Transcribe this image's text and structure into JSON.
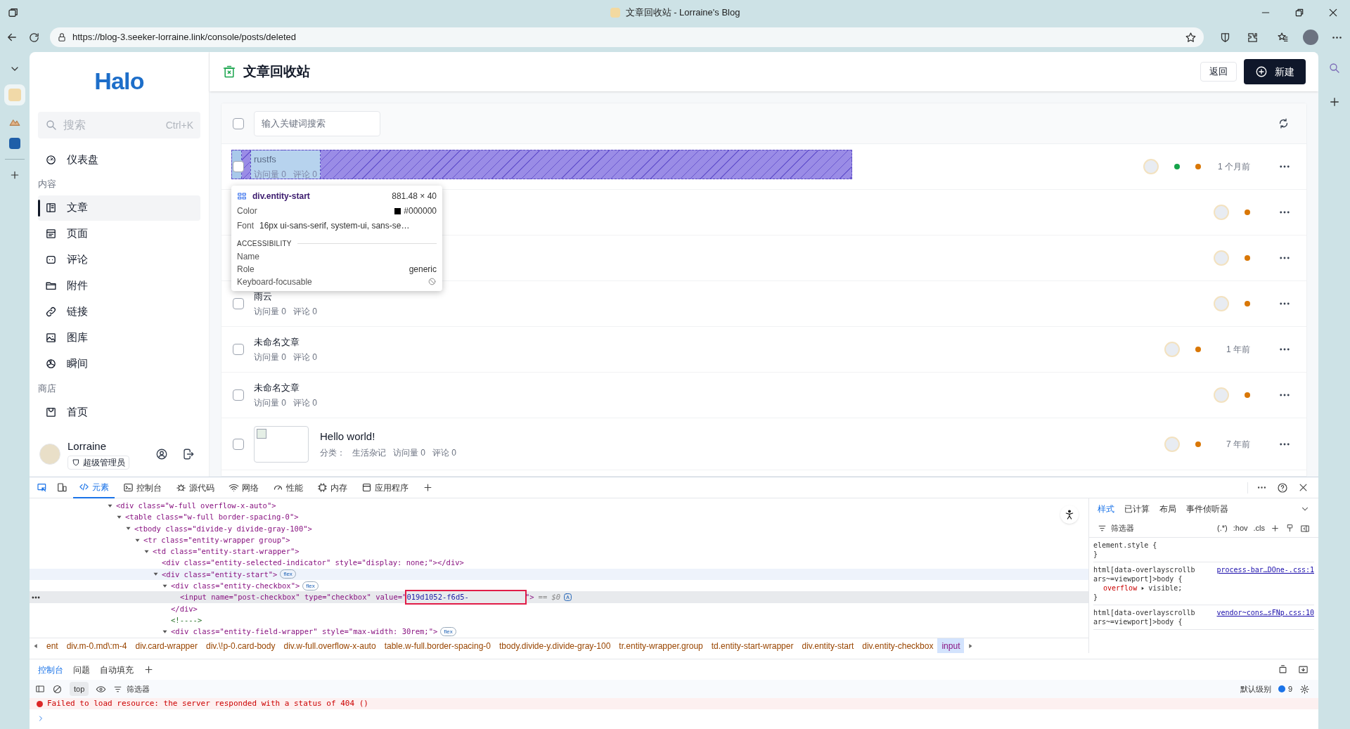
{
  "browser": {
    "title": "文章回收站 - Lorraine's Blog",
    "url": "https://blog-3.seeker-lorraine.link/console/posts/deleted"
  },
  "sidebar": {
    "logo": "Halo",
    "search": {
      "placeholder": "搜索",
      "shortcut": "Ctrl+K"
    },
    "sections": [
      {
        "items": [
          {
            "label": "仪表盘",
            "selected": false
          }
        ]
      },
      {
        "label": "内容",
        "items": [
          {
            "label": "文章",
            "selected": true
          },
          {
            "label": "页面",
            "selected": false
          },
          {
            "label": "评论",
            "selected": false
          },
          {
            "label": "附件",
            "selected": false
          },
          {
            "label": "链接",
            "selected": false
          },
          {
            "label": "图库",
            "selected": false
          },
          {
            "label": "瞬间",
            "selected": false
          }
        ]
      },
      {
        "label": "商店",
        "items": [
          {
            "label": "首页",
            "selected": false
          }
        ]
      }
    ],
    "user": {
      "name": "Lorraine",
      "role": "超级管理员"
    }
  },
  "page": {
    "title": "文章回收站",
    "buttons": [
      {
        "label": "返回",
        "kind": "secondary"
      },
      {
        "label": "新建",
        "kind": "primary"
      }
    ]
  },
  "list": {
    "select_all_checked": false,
    "search_placeholder": "输入关键词搜索",
    "rows": [
      {
        "checked": false,
        "title": "rustfs",
        "meta": [
          "访问量 0",
          "评论 0"
        ],
        "dots": [
          {
            "color": "#16a34a"
          },
          {
            "color": "#d97706"
          }
        ],
        "time": "1 个月前"
      },
      {
        "dots": [
          {
            "color": "#d97706"
          }
        ]
      },
      {
        "dots": [
          {
            "color": "#d97706"
          }
        ]
      },
      {
        "checked": false,
        "title": "雨云",
        "meta": [
          "访问量 0",
          "评论 0"
        ],
        "dots": [
          {
            "color": "#d97706"
          }
        ]
      },
      {
        "checked": false,
        "title": "未命名文章",
        "meta": [
          "访问量 0",
          "评论 0"
        ],
        "dots": [
          {
            "color": "#d97706"
          }
        ],
        "time": "1 年前"
      },
      {
        "checked": false,
        "title": "未命名文章",
        "meta": [
          "访问量 0",
          "评论 0"
        ],
        "dots": [
          {
            "color": "#d97706"
          }
        ]
      },
      {
        "checked": false,
        "title": "Hello world!",
        "thumbnail": true,
        "meta": [
          "分类：",
          "生活杂记",
          "访问量 0",
          "评论 0"
        ],
        "dots": [
          {
            "color": "#d97706"
          }
        ],
        "time": "7 年前"
      }
    ]
  },
  "inspector": {
    "selector": "div.entity-start",
    "size": "881.48 × 40",
    "color_label": "Color",
    "color_value": "#000000",
    "font_label": "Font",
    "font_value": "16px ui-sans-serif, system-ui, sans-se…",
    "section": "ACCESSIBILITY",
    "props": [
      {
        "label": "Name"
      },
      {
        "label": "Role",
        "value": "generic"
      },
      {
        "label": "Keyboard-focusable"
      }
    ]
  },
  "devtools": {
    "tabs": [
      {
        "label": "元素",
        "selected": true
      },
      {
        "label": "控制台",
        "selected": false
      },
      {
        "label": "源代码",
        "selected": false
      },
      {
        "label": "网络",
        "selected": false
      },
      {
        "label": "性能",
        "selected": false
      },
      {
        "label": "内存",
        "selected": false
      },
      {
        "label": "应用程序",
        "selected": false
      }
    ],
    "dom": [
      {
        "text": "<div class=\"w-full overflow-x-auto\">",
        "expanded": true,
        "children": [
          {
            "text": "<table class=\"w-full border-spacing-0\">",
            "expanded": true,
            "children": [
              {
                "text": "<tbody class=\"divide-y divide-gray-100\">",
                "expanded": true,
                "children": [
                  {
                    "text": "<tr class=\"entity-wrapper group\">",
                    "expanded": true,
                    "children": [
                      {
                        "text": "<td class=\"entity-start-wrapper\">",
                        "expanded": true,
                        "children": [
                          {
                            "text": "<div class=\"entity-selected-indicator\" style=\"display: none;\"></div>"
                          },
                          {
                            "text": "<div class=\"entity-start\">",
                            "badge": "flex",
                            "hovered": true,
                            "expanded": true,
                            "children": [
                              {
                                "text": "<div class=\"entity-checkbox\">",
                                "badge": "flex",
                                "expanded": true,
                                "close": "</div>",
                                "children": [
                                  {
                                    "text": "<input name=\"post-checkbox\" type=\"checkbox\" value=\"",
                                    "boxed": "019d1052-f6d5-",
                                    "after": "\">",
                                    "selected": true,
                                    "suffix": "== $0"
                                  }
                                ]
                              },
                              {
                                "text": "<!---->",
                                "kind": "comment"
                              },
                              {
                                "text": "<div class=\"entity-field-wrapper\" style=\"max-width: 30rem;\">",
                                "badge": "flex",
                                "expanded": true
                              }
                            ]
                          }
                        ]
                      }
                    ]
                  }
                ]
              }
            ]
          }
        ]
      }
    ],
    "breadcrumbs": [
      {
        "label": "ent",
        "selected": false
      },
      {
        "label": "div.m-0.md\\:m-4",
        "selected": false
      },
      {
        "label": "div.card-wrapper",
        "selected": false
      },
      {
        "label": "div.\\!p-0.card-body",
        "selected": false
      },
      {
        "label": "div.w-full.overflow-x-auto",
        "selected": false
      },
      {
        "label": "table.w-full.border-spacing-0",
        "selected": false
      },
      {
        "label": "tbody.divide-y.divide-gray-100",
        "selected": false
      },
      {
        "label": "tr.entity-wrapper.group",
        "selected": false
      },
      {
        "label": "td.entity-start-wrapper",
        "selected": false
      },
      {
        "label": "div.entity-start",
        "selected": false
      },
      {
        "label": "div.entity-checkbox",
        "selected": false
      },
      {
        "label": "input",
        "selected": true
      }
    ],
    "styles": {
      "tabs": [
        {
          "label": "样式",
          "selected": true
        },
        {
          "label": "已计算",
          "selected": false
        },
        {
          "label": "布局",
          "selected": false
        },
        {
          "label": "事件侦听器",
          "selected": false
        }
      ],
      "filter": "筛选器",
      "tools": [
        "(.*)",
        ":hov",
        ".cls"
      ],
      "rules": [
        {
          "selector": "element.style {",
          "close": "}"
        },
        {
          "selector": "html[data-overlayscrollbars~=viewport]>body {",
          "source": "process-bar…DOne-.css:1",
          "props": [
            {
              "name": "overflow",
              "value": "visible;"
            }
          ],
          "close": "}"
        },
        {
          "selector": "html[data-overlayscrollbars~=viewport]>body {",
          "source": "vendor~cons…sFNp.css:10"
        }
      ]
    },
    "console": {
      "tabs": [
        {
          "label": "控制台",
          "selected": true
        },
        {
          "label": "问题",
          "selected": false
        },
        {
          "label": "自动填充",
          "selected": false
        }
      ],
      "context": "top",
      "filter": "筛选器",
      "level": "默认级别",
      "count": "9",
      "messages": [
        {
          "kind": "error",
          "text": "Failed to load resource: the server responded with a status of 404 ()"
        }
      ]
    }
  }
}
